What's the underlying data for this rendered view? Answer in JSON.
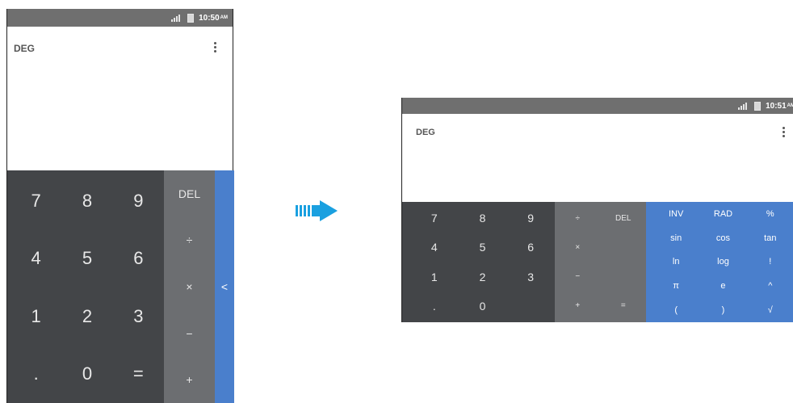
{
  "colors": {
    "numpad": "#434548",
    "ops": "#6c6e71",
    "advanced": "#4a7fcc",
    "status_bar": "#6f6f6f",
    "arrow": "#1aa0e0"
  },
  "portrait": {
    "status": {
      "time": "10:50",
      "ampm": "AM"
    },
    "display": {
      "mode": "DEG"
    },
    "numpad": [
      "7",
      "8",
      "9",
      "4",
      "5",
      "6",
      "1",
      "2",
      "3",
      ".",
      "0",
      "="
    ],
    "ops": [
      "DEL",
      "÷",
      "×",
      "−",
      "+"
    ],
    "tab_icon": "chevron-left-icon",
    "tab_glyph": "<"
  },
  "landscape": {
    "status": {
      "time": "10:51",
      "ampm": "AM"
    },
    "display": {
      "mode": "DEG"
    },
    "numpad": [
      "7",
      "8",
      "9",
      "4",
      "5",
      "6",
      "1",
      "2",
      "3",
      ".",
      "0",
      ""
    ],
    "ops": [
      "÷",
      "DEL",
      "×",
      "",
      "−",
      "",
      "+",
      "="
    ],
    "advanced": [
      "INV",
      "RAD",
      "%",
      "sin",
      "cos",
      "tan",
      "ln",
      "log",
      "!",
      "π",
      "e",
      "^",
      "(",
      ")",
      "√"
    ]
  },
  "transition_icon": "arrow-right-icon"
}
